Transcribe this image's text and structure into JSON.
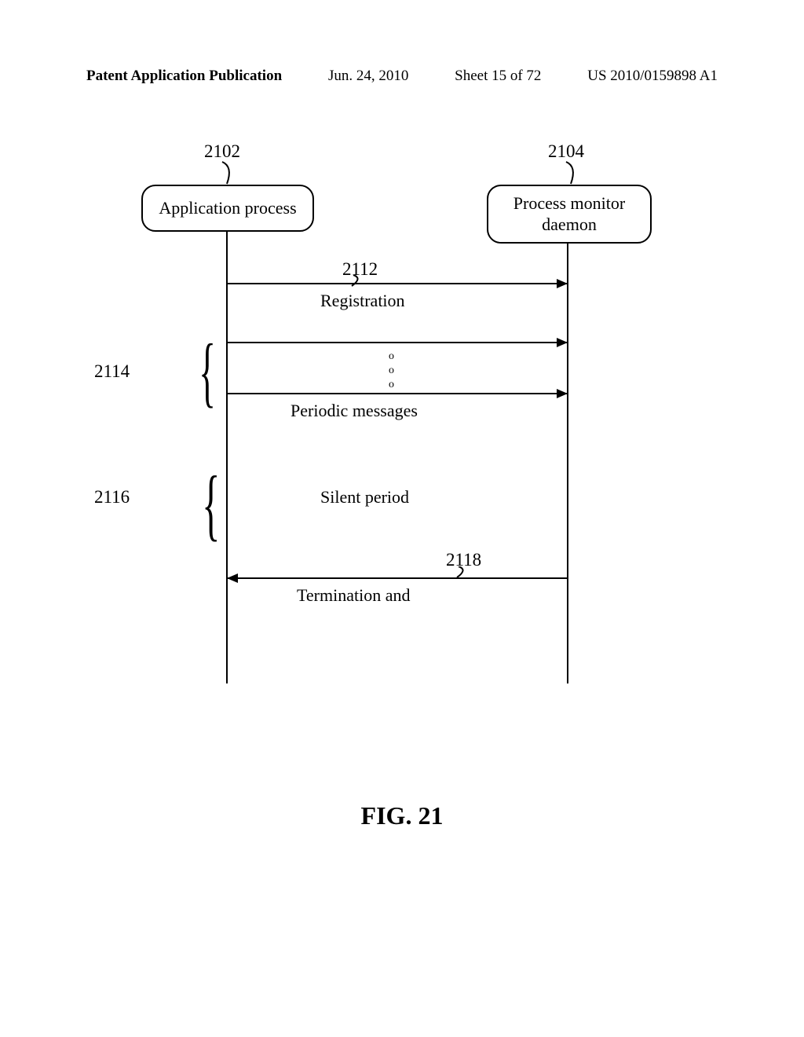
{
  "header": {
    "left": "Patent Application Publication",
    "date": "Jun. 24, 2010",
    "sheet": "Sheet 15 of 72",
    "pubno": "US 2010/0159898 A1"
  },
  "refs": {
    "r2102": "2102",
    "r2104": "2104",
    "r2112": "2112",
    "r2114": "2114",
    "r2116": "2116",
    "r2118": "2118"
  },
  "boxes": {
    "left": "Application process",
    "right_line1": "Process monitor",
    "right_line2": "daemon"
  },
  "messages": {
    "registration": "Registration",
    "periodic": "Periodic messages",
    "silent": "Silent period",
    "termination": "Termination and"
  },
  "dots": {
    "d1": "o",
    "d2": "o",
    "d3": "o"
  },
  "figure": "FIG. 21"
}
